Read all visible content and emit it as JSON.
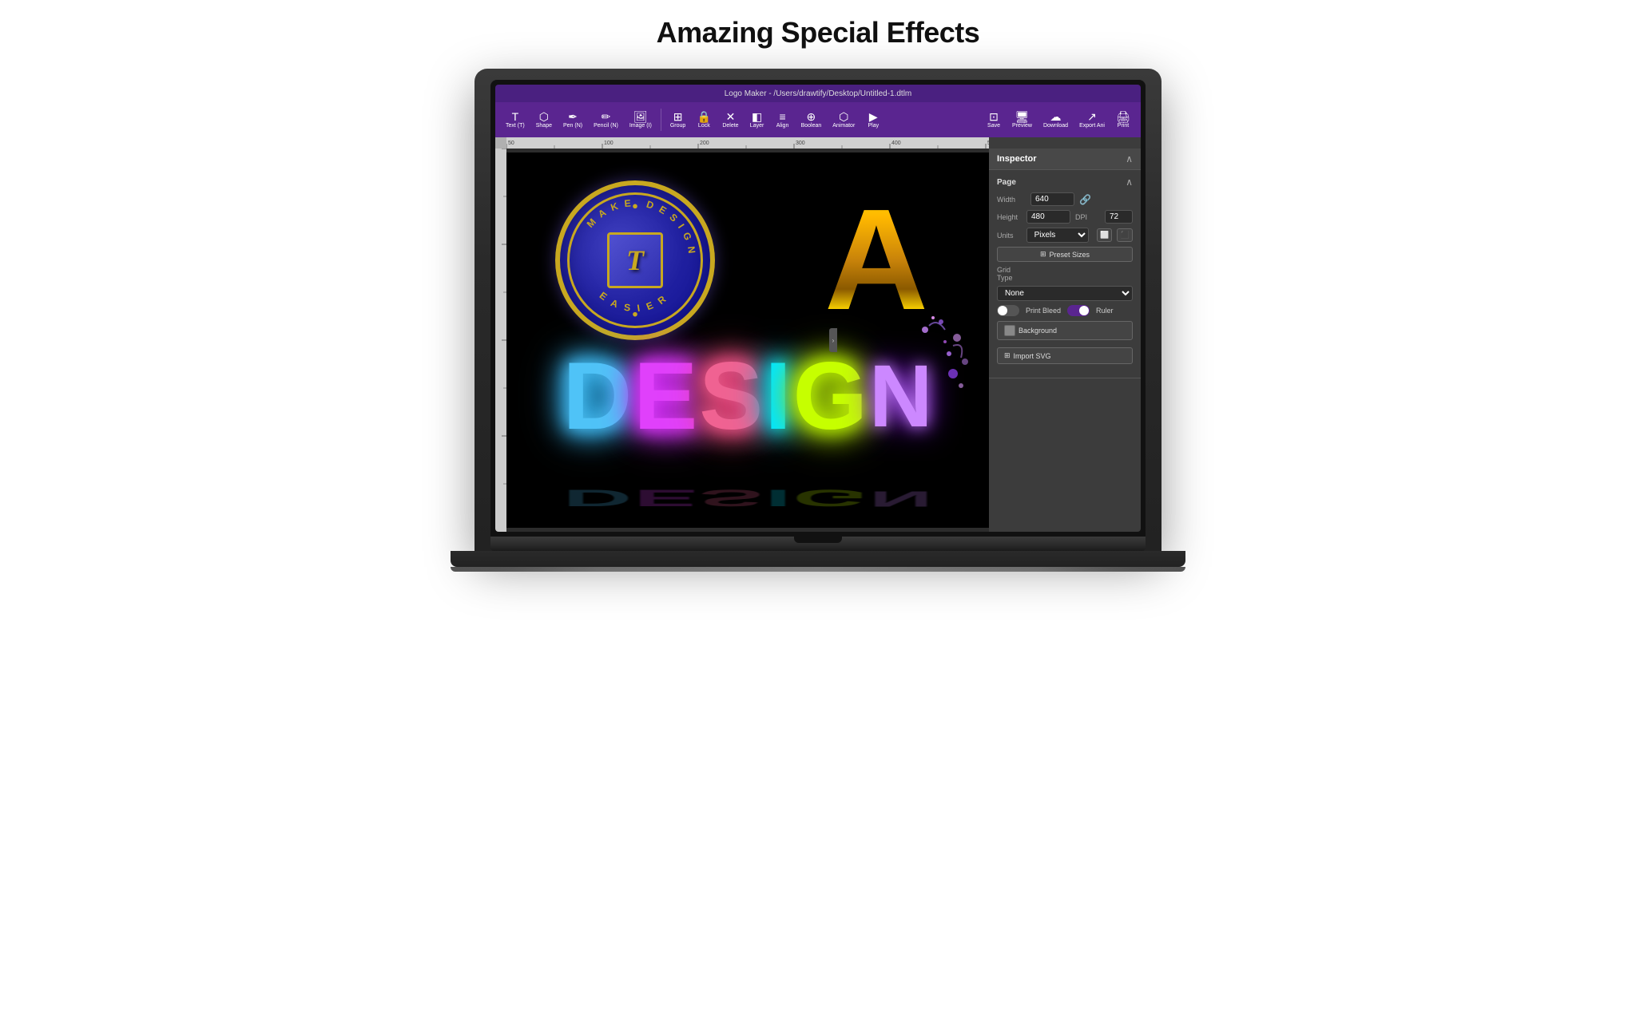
{
  "page": {
    "title": "Amazing Special Effects"
  },
  "titlebar": {
    "text": "Logo Maker - /Users/drawtify/Desktop/Untitled-1.dtlm"
  },
  "toolbar": {
    "tools": [
      {
        "name": "text",
        "icon": "T",
        "label": "Text (T)"
      },
      {
        "name": "shape",
        "icon": "⬡",
        "label": "Shape"
      },
      {
        "name": "pen",
        "icon": "✒",
        "label": "Pen (N)"
      },
      {
        "name": "pencil",
        "icon": "✏",
        "label": "Pencil (N)"
      },
      {
        "name": "image",
        "icon": "🖼",
        "label": "Image (I)"
      },
      {
        "name": "group",
        "icon": "⊞",
        "label": "Group"
      },
      {
        "name": "lock",
        "icon": "🔒",
        "label": "Lock"
      },
      {
        "name": "delete",
        "icon": "✕",
        "label": "Delete"
      },
      {
        "name": "layer",
        "icon": "◧",
        "label": "Layer"
      },
      {
        "name": "align",
        "icon": "≡",
        "label": "Align"
      },
      {
        "name": "boolean",
        "icon": "⊕",
        "label": "Boolean"
      },
      {
        "name": "animator",
        "icon": "▶",
        "label": "Animator"
      },
      {
        "name": "play",
        "icon": "▷",
        "label": "Play"
      }
    ],
    "right": [
      {
        "name": "save",
        "icon": "⊡",
        "label": "Save"
      },
      {
        "name": "preview",
        "icon": "🖥",
        "label": "Preview"
      },
      {
        "name": "download",
        "icon": "☁",
        "label": "Download"
      },
      {
        "name": "export-ani",
        "icon": "↗",
        "label": "Export Ani"
      },
      {
        "name": "print",
        "icon": "🖨",
        "label": "Print"
      }
    ]
  },
  "inspector": {
    "title": "Inspector",
    "sections": {
      "page": {
        "label": "Page",
        "width": "640",
        "height": "480",
        "dpi": "72",
        "units": "Pixels",
        "preset_btn": "Preset Sizes",
        "grid_type_label": "Grid Type",
        "grid_type": "None",
        "print_bleed_label": "Print Bleed",
        "ruler_label": "Ruler",
        "background_label": "Background",
        "import_svg_label": "Import SVG"
      }
    }
  },
  "design": {
    "badge_letter": "T",
    "badge_text_top": "MAKE DESIGN",
    "badge_text_bottom": "EASIER",
    "gold_letter": "A",
    "design_letters": [
      "D",
      "E",
      "S",
      "I",
      "G",
      "N"
    ]
  }
}
